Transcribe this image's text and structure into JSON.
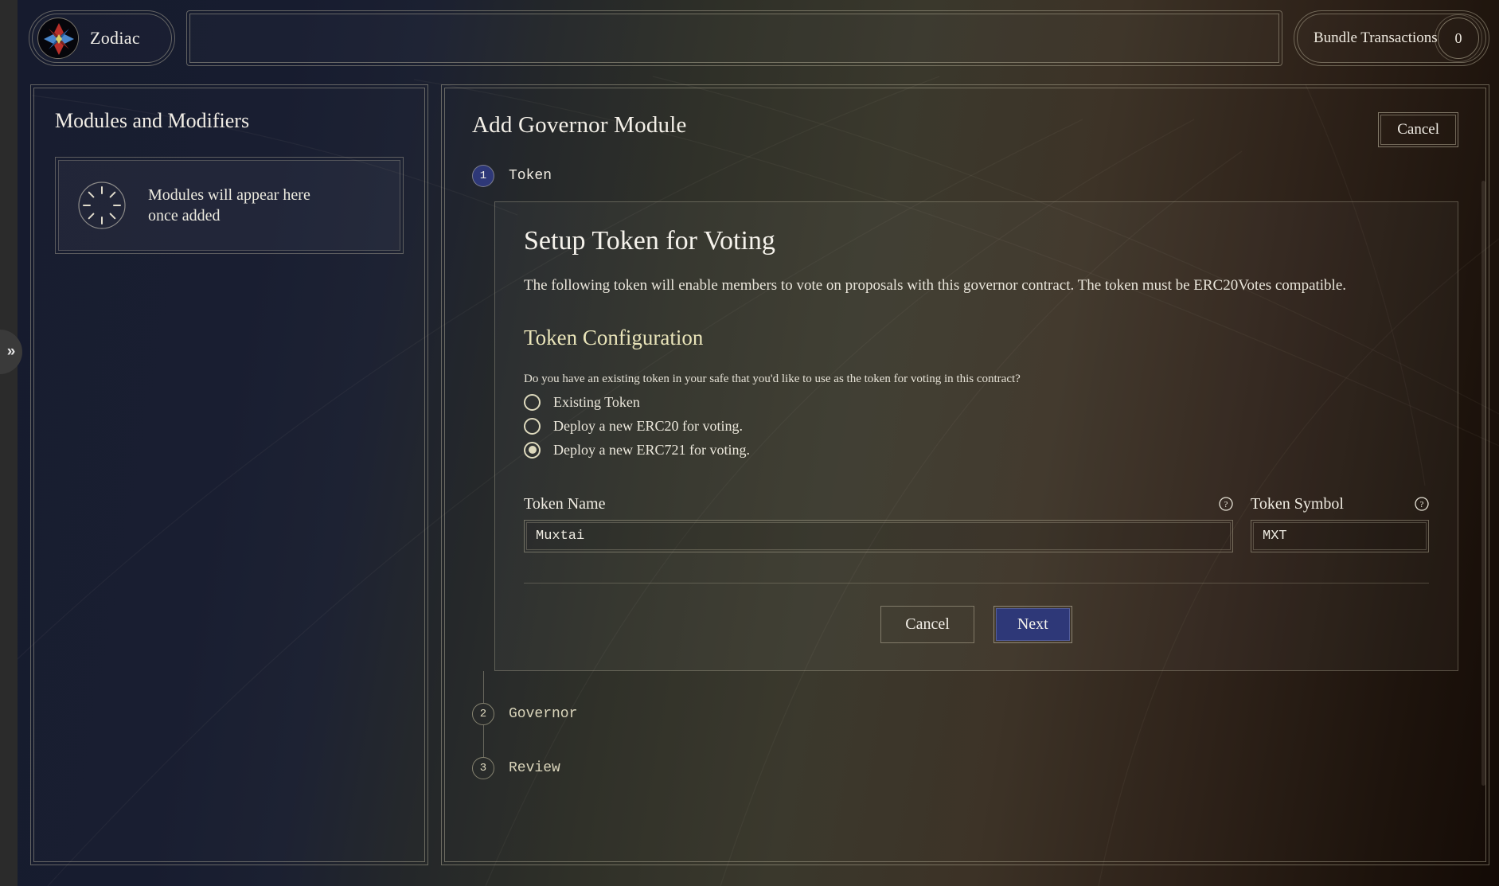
{
  "header": {
    "brand_name": "Zodiac",
    "brand_logo_icon": "zodiac-orb-logo",
    "address_bar_value": "",
    "address_bar_placeholder": "",
    "bundle_label": "Bundle Transactions",
    "bundle_count": "0"
  },
  "rail": {
    "expand_icon": "»"
  },
  "sidebar": {
    "title": "Modules and Modifiers",
    "empty_icon": "radial-tick-circle-icon",
    "empty_line1": "Modules will appear here",
    "empty_line2": "once added"
  },
  "main": {
    "title": "Add Governor Module",
    "cancel_label": "Cancel",
    "steps": [
      {
        "number": "1",
        "label": "Token",
        "state": "active"
      },
      {
        "number": "2",
        "label": "Governor",
        "state": "idle"
      },
      {
        "number": "3",
        "label": "Review",
        "state": "idle"
      }
    ],
    "card": {
      "heading": "Setup Token for Voting",
      "description": "The following token will enable members to vote on proposals with this governor contract. The token must be ERC20Votes compatible.",
      "section_heading": "Token Configuration",
      "question": "Do you have an existing token in your safe that you'd like to use as the token for voting in this contract?",
      "options": [
        {
          "label": "Existing Token",
          "selected": false
        },
        {
          "label": "Deploy a new ERC20 for voting.",
          "selected": false
        },
        {
          "label": "Deploy a new ERC721 for voting.",
          "selected": true
        }
      ],
      "token_name": {
        "label": "Token Name",
        "value": "Muxtai",
        "placeholder": "",
        "help_icon": "question-circle-icon"
      },
      "token_symbol": {
        "label": "Token Symbol",
        "value": "MXT",
        "placeholder": "",
        "help_icon": "question-circle-icon"
      },
      "cancel_label": "Cancel",
      "next_label": "Next"
    }
  },
  "colors": {
    "accent_blue": "#2e3878",
    "cream": "#ddd9bd",
    "section_heading": "#e9e4b9",
    "navy_bg": "#161b2e",
    "olive_bg": "#3a382c"
  }
}
